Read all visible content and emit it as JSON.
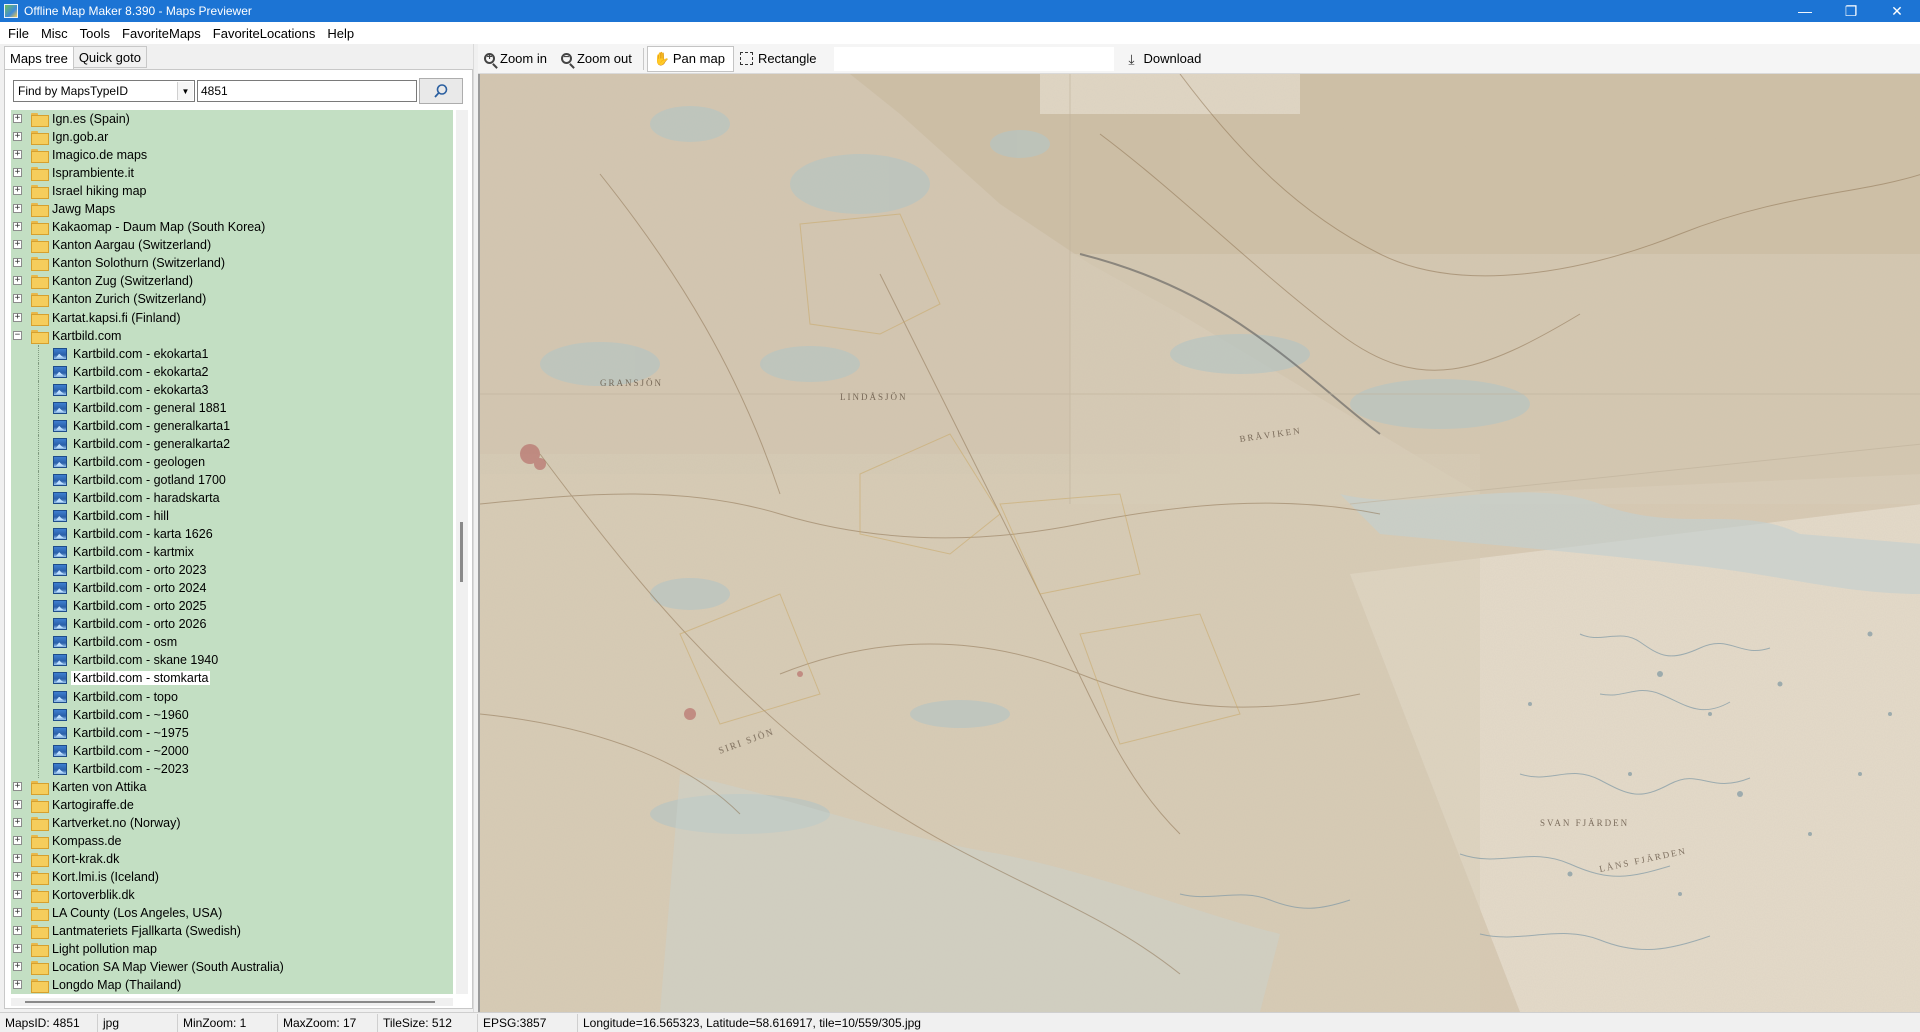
{
  "window": {
    "title": "Offline Map Maker 8.390 - Maps Previewer",
    "buttons": {
      "minimize": "—",
      "restore": "❐",
      "close": "✕"
    }
  },
  "menu": [
    "File",
    "Misc",
    "Tools",
    "FavoriteMaps",
    "FavoriteLocations",
    "Help"
  ],
  "left_panel": {
    "tabs": [
      "Maps tree",
      "Quick goto"
    ],
    "find_by": "Find by MapsTypeID",
    "search_value": "4851",
    "tree": [
      {
        "label": "Ign.es (Spain)",
        "type": "folder"
      },
      {
        "label": "Ign.gob.ar",
        "type": "folder"
      },
      {
        "label": "Imagico.de maps",
        "type": "folder"
      },
      {
        "label": "Isprambiente.it",
        "type": "folder"
      },
      {
        "label": "Israel hiking map",
        "type": "folder"
      },
      {
        "label": "Jawg Maps",
        "type": "folder"
      },
      {
        "label": "Kakaomap - Daum Map (South Korea)",
        "type": "folder"
      },
      {
        "label": "Kanton Aargau (Switzerland)",
        "type": "folder"
      },
      {
        "label": "Kanton Solothurn (Switzerland)",
        "type": "folder"
      },
      {
        "label": "Kanton Zug (Switzerland)",
        "type": "folder"
      },
      {
        "label": "Kanton Zurich (Switzerland)",
        "type": "folder"
      },
      {
        "label": "Kartat.kapsi.fi (Finland)",
        "type": "folder"
      },
      {
        "label": "Kartbild.com",
        "type": "folder-open"
      },
      {
        "label": "Kartbild.com - ekokarta1",
        "type": "map"
      },
      {
        "label": "Kartbild.com - ekokarta2",
        "type": "map"
      },
      {
        "label": "Kartbild.com - ekokarta3",
        "type": "map"
      },
      {
        "label": "Kartbild.com - general 1881",
        "type": "map"
      },
      {
        "label": "Kartbild.com - generalkarta1",
        "type": "map"
      },
      {
        "label": "Kartbild.com - generalkarta2",
        "type": "map"
      },
      {
        "label": "Kartbild.com - geologen",
        "type": "map"
      },
      {
        "label": "Kartbild.com - gotland 1700",
        "type": "map"
      },
      {
        "label": "Kartbild.com - haradskarta",
        "type": "map"
      },
      {
        "label": "Kartbild.com - hill",
        "type": "map"
      },
      {
        "label": "Kartbild.com - karta 1626",
        "type": "map"
      },
      {
        "label": "Kartbild.com - kartmix",
        "type": "map"
      },
      {
        "label": "Kartbild.com - orto 2023",
        "type": "map"
      },
      {
        "label": "Kartbild.com - orto 2024",
        "type": "map"
      },
      {
        "label": "Kartbild.com - orto 2025",
        "type": "map"
      },
      {
        "label": "Kartbild.com - orto 2026",
        "type": "map"
      },
      {
        "label": "Kartbild.com - osm",
        "type": "map"
      },
      {
        "label": "Kartbild.com - skane 1940",
        "type": "map"
      },
      {
        "label": "Kartbild.com - stomkarta",
        "type": "map",
        "selected": true
      },
      {
        "label": "Kartbild.com - topo",
        "type": "map"
      },
      {
        "label": "Kartbild.com - ~1960",
        "type": "map"
      },
      {
        "label": "Kartbild.com - ~1975",
        "type": "map"
      },
      {
        "label": "Kartbild.com - ~2000",
        "type": "map"
      },
      {
        "label": "Kartbild.com - ~2023",
        "type": "map"
      },
      {
        "label": "Karten von Attika",
        "type": "folder"
      },
      {
        "label": "Kartogiraffe.de",
        "type": "folder"
      },
      {
        "label": "Kartverket.no (Norway)",
        "type": "folder"
      },
      {
        "label": "Kompass.de",
        "type": "folder"
      },
      {
        "label": "Kort-krak.dk",
        "type": "folder"
      },
      {
        "label": "Kort.lmi.is (Iceland)",
        "type": "folder"
      },
      {
        "label": "Kortoverblik.dk",
        "type": "folder"
      },
      {
        "label": "LA County (Los Angeles, USA)",
        "type": "folder"
      },
      {
        "label": "Lantmateriets Fjallkarta (Swedish)",
        "type": "folder"
      },
      {
        "label": "Light pollution map",
        "type": "folder"
      },
      {
        "label": "Location SA Map Viewer (South Australia)",
        "type": "folder"
      },
      {
        "label": "Longdo Map (Thailand)",
        "type": "folder"
      }
    ]
  },
  "toolbar": {
    "zoom_in": "Zoom in",
    "zoom_out": "Zoom out",
    "pan_map": "Pan map",
    "rectangle": "Rectangle",
    "download": "Download"
  },
  "map_labels": [
    "BRÅVIKEN",
    "SVAN FJÄRDEN",
    "LÅNS FJÄRDEN",
    "GRANSJÖN",
    "LINDÅSJÖN",
    "SIRI SJÖN"
  ],
  "status": {
    "maps_id": "MapsID: 4851",
    "format": "jpg",
    "min_zoom": "MinZoom: 1",
    "max_zoom": "MaxZoom: 17",
    "tile_size": "TileSize: 512",
    "epsg": "EPSG:3857",
    "coords": "Longitude=16.565323, Latitude=58.616917, tile=10/559/305.jpg"
  },
  "colors": {
    "titlebar": "#1c74d4",
    "tree_bg": "#c3dfc3",
    "map_base": "#d8cbb6"
  }
}
